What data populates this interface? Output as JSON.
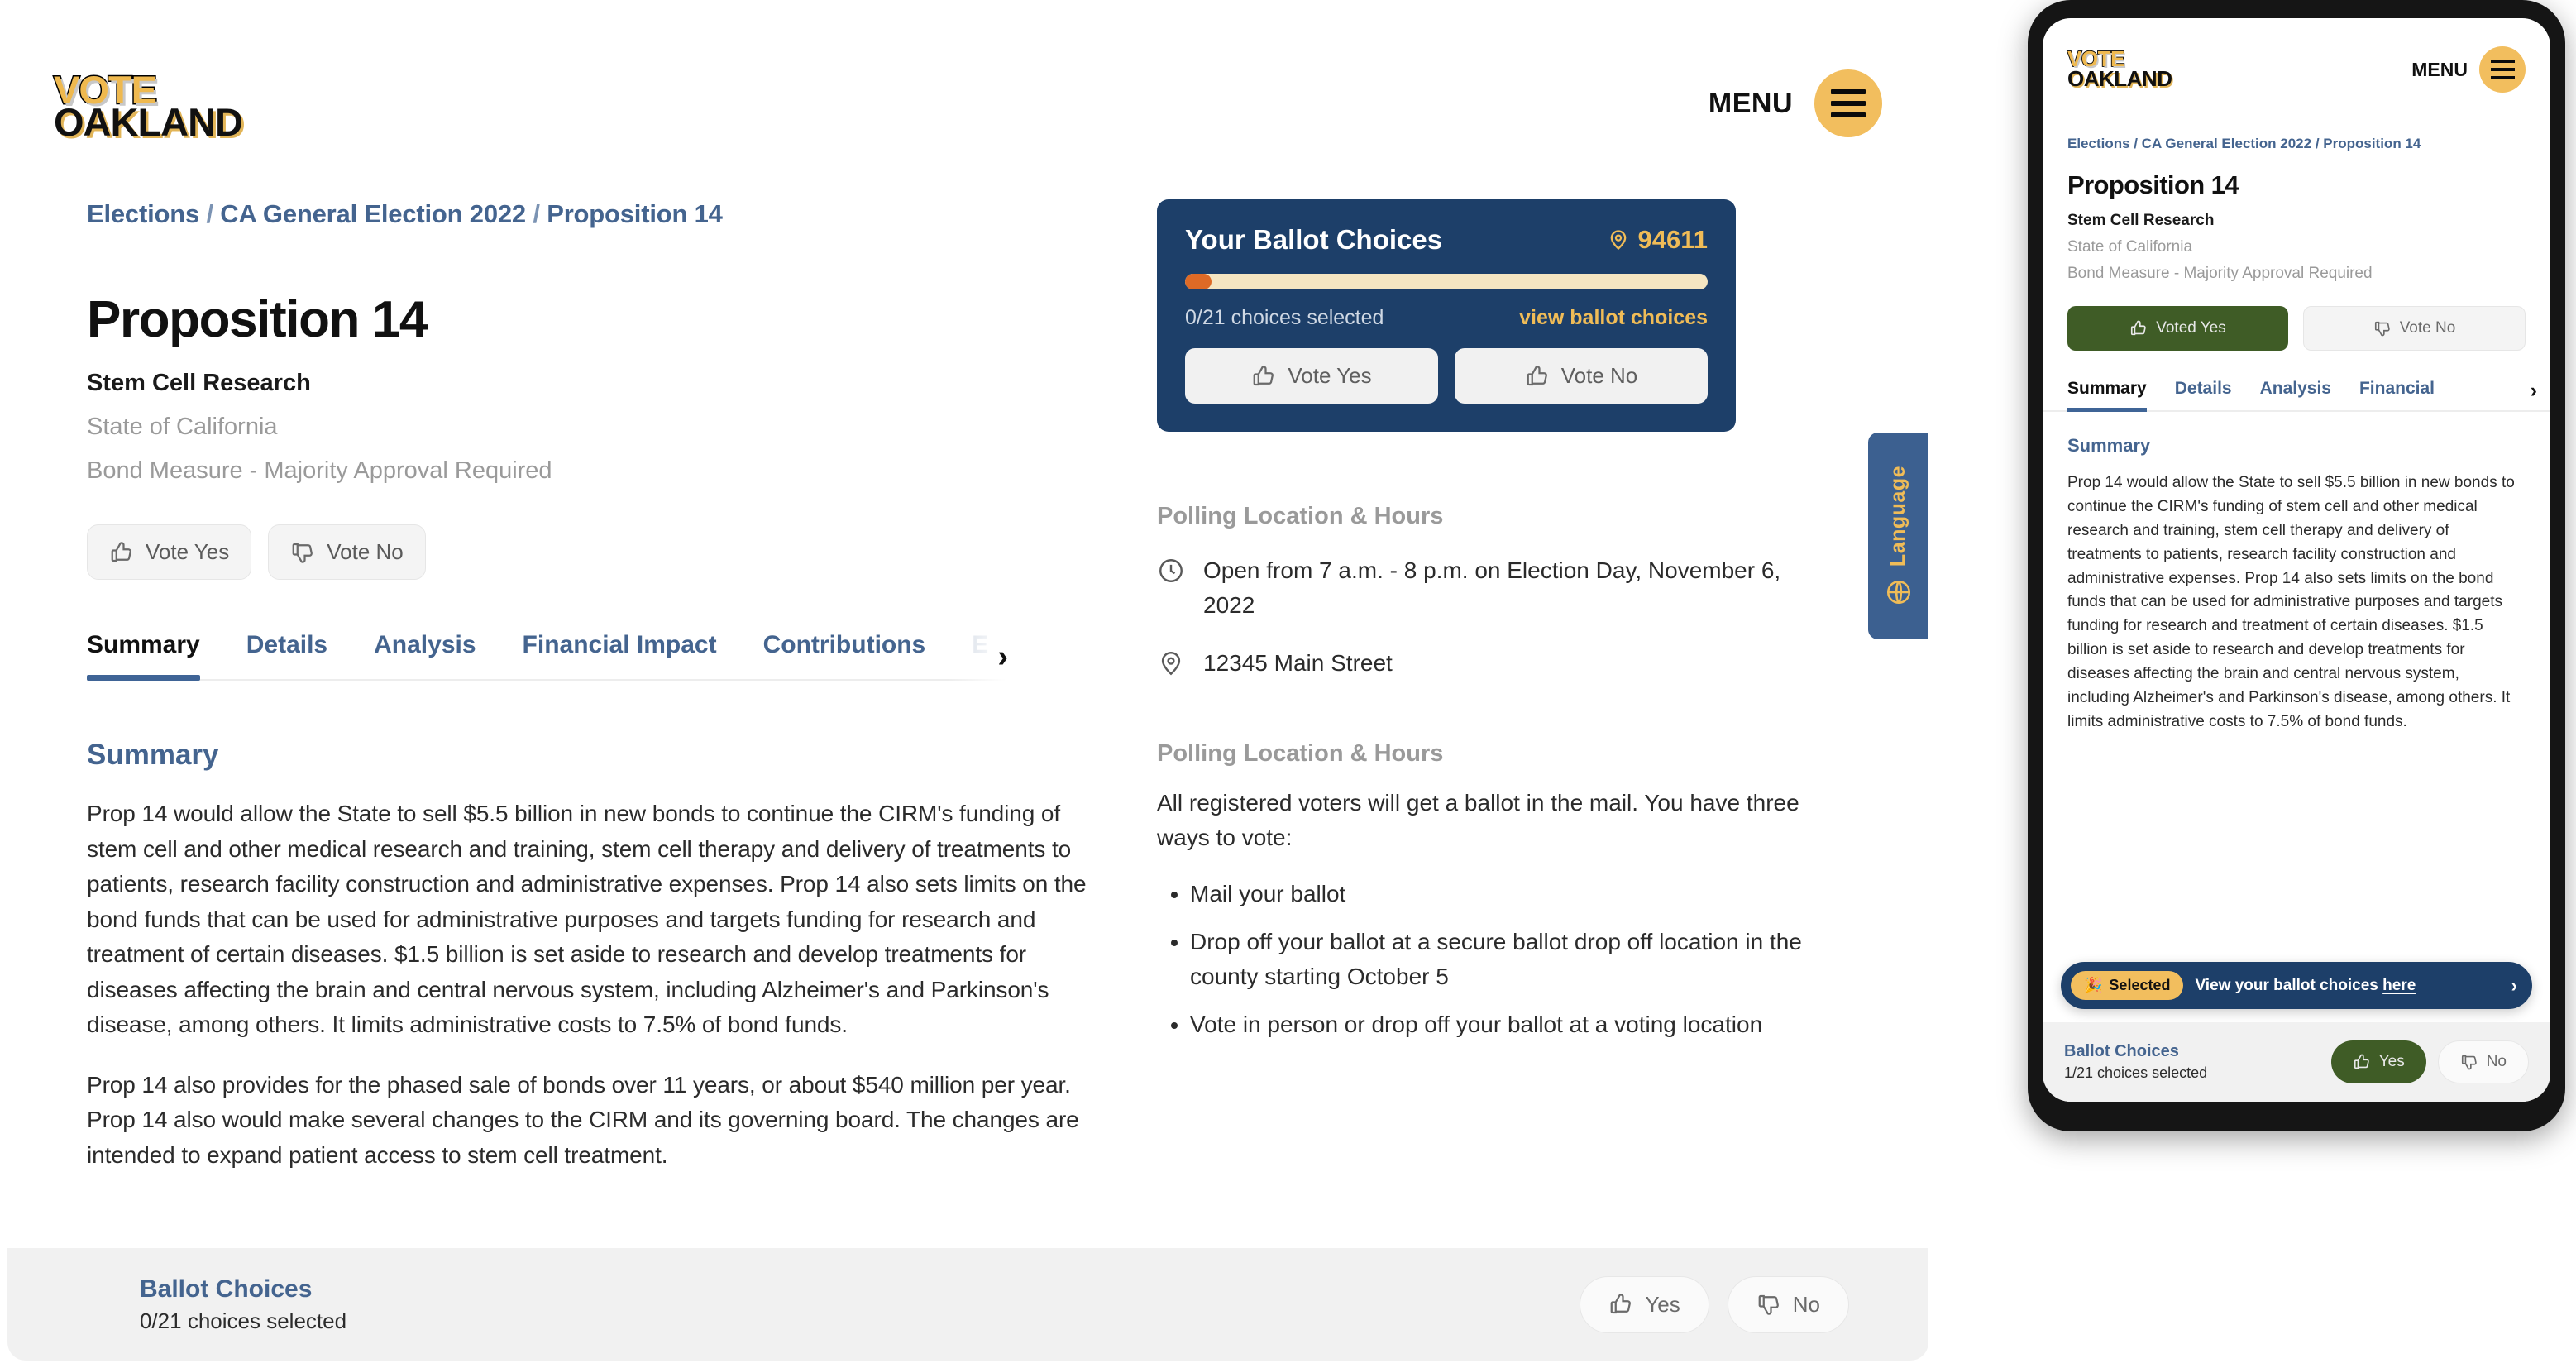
{
  "brand": {
    "line1": "VOTE",
    "line2": "OAKLAND"
  },
  "header": {
    "menu_label": "MENU",
    "menu_icon": "hamburger-icon"
  },
  "breadcrumb": {
    "items": [
      "Elections",
      "CA General Election 2022",
      "Proposition 14"
    ],
    "separator": "/"
  },
  "measure": {
    "title": "Proposition 14",
    "subtitle": "Stem Cell Research",
    "jurisdiction": "State of California",
    "type": "Bond Measure - Majority Approval Required"
  },
  "vote_buttons": {
    "yes_label": "Vote Yes",
    "no_label": "Vote No",
    "yes_icon": "thumbs-up-icon",
    "no_icon": "thumbs-down-icon"
  },
  "tabs": {
    "items": [
      "Summary",
      "Details",
      "Analysis",
      "Financial Impact",
      "Contributions"
    ],
    "hidden_next": "E",
    "active": "Summary",
    "scroll_icon": "chevron-right-icon"
  },
  "summary": {
    "heading": "Summary",
    "paragraph1": "Prop 14 would allow the State to sell $5.5 billion in new bonds to continue the CIRM's funding of stem cell and other medical research and training, stem cell therapy and delivery of treatments to patients, research facility construction and administrative expenses. Prop 14 also sets limits on the bond funds that can be used for administrative purposes and targets funding for research and treatment of certain diseases. $1.5 billion is set aside to research and develop treatments for diseases affecting the brain and central nervous system, including Alzheimer's and Parkinson's disease, among others. It limits administrative costs to 7.5% of bond funds.",
    "paragraph2": "Prop 14 also provides for the phased sale of bonds over 11 years, or about $540 million per year. Prop 14 also would make several changes to the CIRM and its governing board. The changes are intended to expand patient access to stem cell treatment."
  },
  "ballot_card": {
    "title": "Your Ballot Choices",
    "zip": "94611",
    "zip_icon": "map-pin-icon",
    "progress_percent": 5,
    "count_label": "0/21 choices selected",
    "view_link": "view ballot choices",
    "yes_label": "Vote Yes",
    "no_label": "Vote No"
  },
  "language_tab": {
    "label": "Language",
    "icon": "globe-icon"
  },
  "polling": {
    "heading": "Polling Location & Hours",
    "hours_icon": "clock-icon",
    "hours": "Open from 7 a.m. - 8 p.m. on Election Day, November 6, 2022",
    "address_icon": "map-pin-icon",
    "address": "12345 Main Street"
  },
  "polling2": {
    "heading": "Polling Location & Hours",
    "intro": "All registered voters will get a ballot in the mail. You have three ways to vote:",
    "bullets": [
      "Mail your ballot",
      "Drop off your ballot at a secure ballot drop off location in the county starting October 5",
      "Vote in person or drop off your ballot at a voting location"
    ]
  },
  "bottom_bar": {
    "title": "Ballot Choices",
    "count_label": "0/21 choices selected",
    "yes_label": "Yes",
    "no_label": "No"
  },
  "mobile": {
    "breadcrumb": "Elections / CA General Election 2022 / Proposition 14",
    "title": "Proposition 14",
    "subtitle": "Stem Cell Research",
    "jurisdiction": "State of California",
    "type": "Bond Measure - Majority Approval Required",
    "voted_yes_label": "Voted Yes",
    "vote_no_label": "Vote No",
    "tabs": [
      "Summary",
      "Details",
      "Analysis",
      "Financial"
    ],
    "tab_active": "Summary",
    "summary_heading": "Summary",
    "summary_text": "Prop 14 would allow the State to sell $5.5 billion in new bonds to continue the CIRM's funding of stem cell and other medical research and training, stem cell therapy and delivery of treatments to patients, research facility construction and administrative expenses. Prop 14 also sets limits on the bond funds that can be used for administrative purposes and targets funding for research and treatment of certain diseases. $1.5 billion is set aside to research and develop treatments for diseases affecting the brain and central nervous system, including Alzheimer's and Parkinson's disease, among others. It limits administrative costs to 7.5% of bond funds.",
    "toast": {
      "badge_label": "Selected",
      "badge_icon": "confetti-icon",
      "text_prefix": "View your ballot choices ",
      "text_link": "here",
      "chevron": "›"
    },
    "bottom": {
      "title": "Ballot Choices",
      "count_label": "1/21 choices selected",
      "yes_label": "Yes",
      "no_label": "No"
    }
  },
  "colors": {
    "brand_gold": "#f2be5e",
    "navy": "#1d3f69",
    "link_blue": "#44648f",
    "orange": "#de6a26",
    "green": "#3f5c26"
  }
}
